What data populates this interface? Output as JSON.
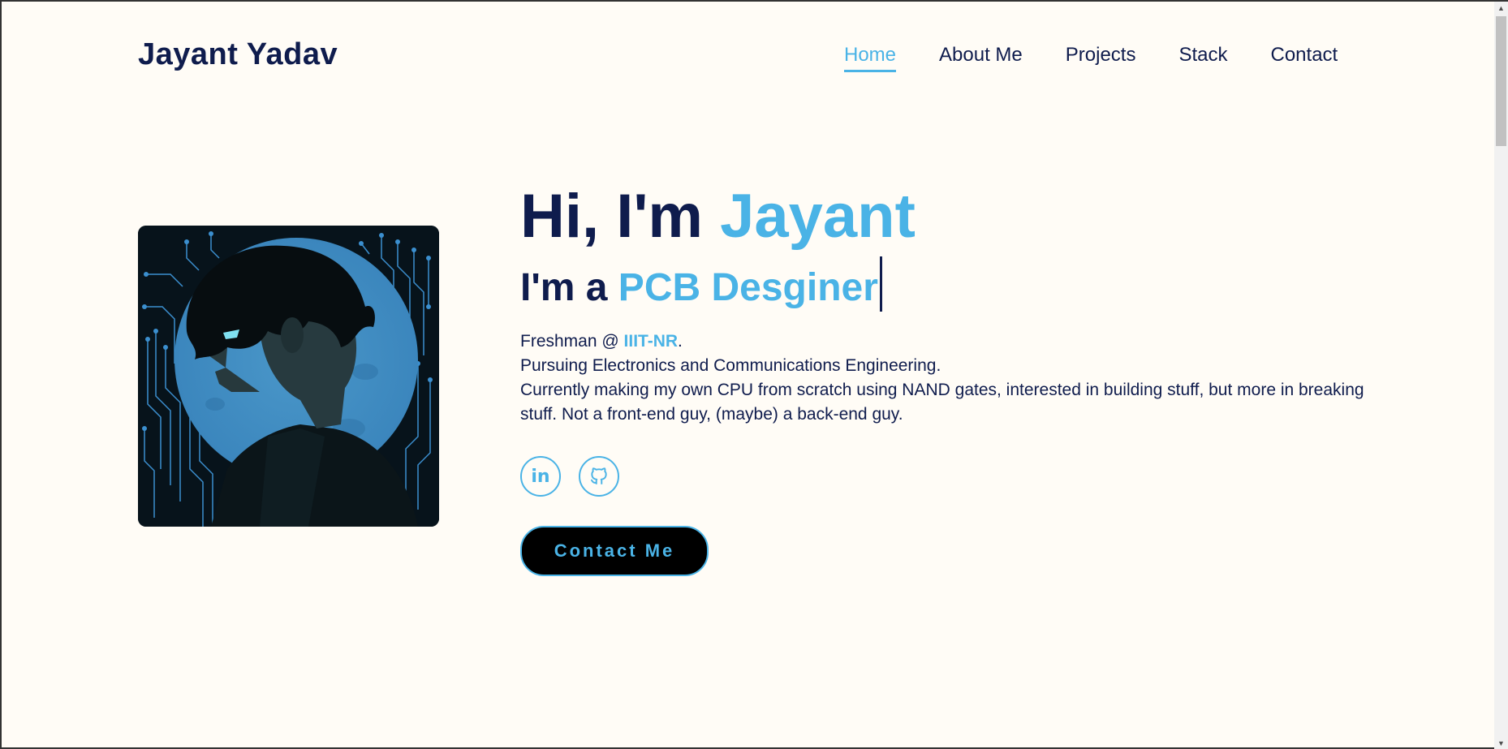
{
  "header": {
    "logo": "Jayant Yadav",
    "nav": [
      {
        "label": "Home",
        "active": true
      },
      {
        "label": "About Me",
        "active": false
      },
      {
        "label": "Projects",
        "active": false
      },
      {
        "label": "Stack",
        "active": false
      },
      {
        "label": "Contact",
        "active": false
      }
    ]
  },
  "hero": {
    "greeting_prefix": "Hi, I'm ",
    "greeting_name": "Jayant",
    "role_prefix": "I'm a ",
    "role_value": "PCB Desginer",
    "line1_prefix": "Freshman @ ",
    "line1_org": "IIIT-NR",
    "line1_suffix": ".",
    "line2": "Pursuing Electronics and Communications Engineering.",
    "line3": "Currently making my own CPU from scratch using NAND gates, interested in building stuff, but more in breaking stuff. Not a front-end guy, (maybe) a back-end guy.",
    "contact_button": "Contact Me"
  },
  "socials": [
    {
      "icon": "linkedin-icon"
    },
    {
      "icon": "github-icon"
    }
  ],
  "colors": {
    "navy": "#0f1c4d",
    "accent": "#4ab3e6",
    "background": "#fffcf6"
  }
}
